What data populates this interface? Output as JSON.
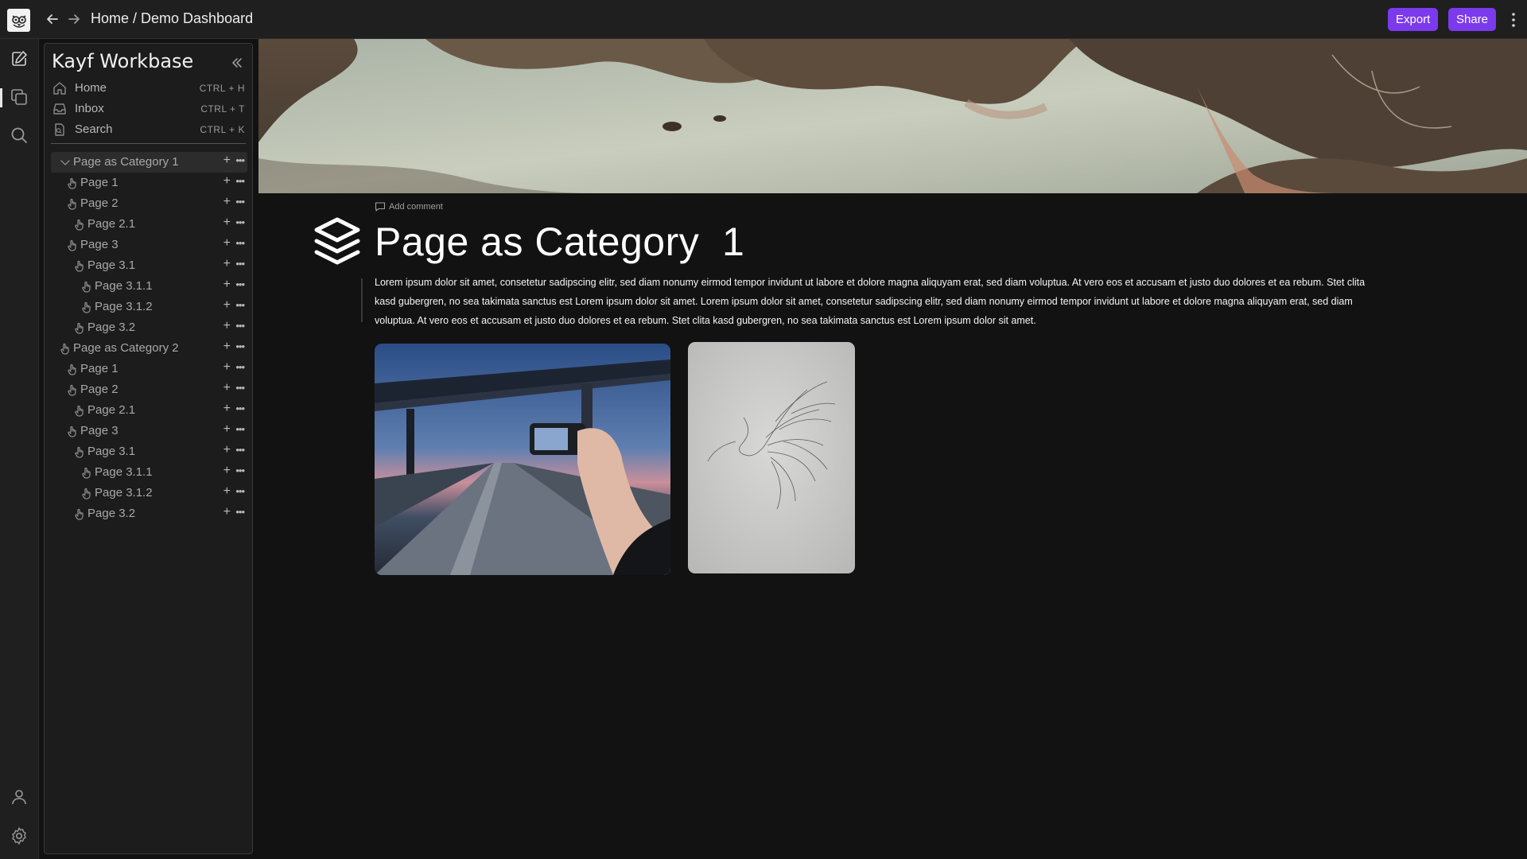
{
  "topbar": {
    "breadcrumb_home": "Home",
    "breadcrumb_sep": " / ",
    "breadcrumb_page": "Demo Dashboard",
    "export_label": "Export",
    "share_label": "Share",
    "accent": "#7c3aed"
  },
  "rail": {
    "icons": [
      "edit-icon",
      "copy-icon",
      "search-icon",
      "user-icon",
      "settings-icon"
    ]
  },
  "sidebar": {
    "title": "Kayf Workbase",
    "quick": [
      {
        "label": "Home",
        "shortcut": "CTRL + H",
        "icon": "home-icon"
      },
      {
        "label": "Inbox",
        "shortcut": "CTRL + T",
        "icon": "inbox-icon"
      },
      {
        "label": "Search",
        "shortcut": "CTRL + K",
        "icon": "search-doc-icon"
      }
    ],
    "tree": [
      {
        "label": "Page as Category 1",
        "level": 0,
        "expanded": true
      },
      {
        "label": "Page 1",
        "level": 1
      },
      {
        "label": "Page 2",
        "level": 1
      },
      {
        "label": "Page 2.1",
        "level": 2
      },
      {
        "label": "Page 3",
        "level": 1
      },
      {
        "label": "Page 3.1",
        "level": 2
      },
      {
        "label": "Page 3.1.1",
        "level": 3
      },
      {
        "label": "Page 3.1.2",
        "level": 3
      },
      {
        "label": "Page 3.2",
        "level": 2
      },
      {
        "label": "Page as Category 2",
        "level": 0
      },
      {
        "label": "Page 1",
        "level": 1
      },
      {
        "label": "Page 2",
        "level": 1
      },
      {
        "label": "Page 2.1",
        "level": 2
      },
      {
        "label": "Page 3",
        "level": 1
      },
      {
        "label": "Page 3.1",
        "level": 2
      },
      {
        "label": "Page 3.1.1",
        "level": 3
      },
      {
        "label": "Page 3.1.2",
        "level": 3
      },
      {
        "label": "Page 3.2",
        "level": 2
      }
    ]
  },
  "main": {
    "add_comment": "Add comment",
    "title": "Page as Category  1",
    "body": "Lorem ipsum dolor sit amet, consetetur sadipscing elitr, sed diam nonumy eirmod tempor invidunt ut labore et dolore magna aliquyam erat, sed diam voluptua. At vero eos et accusam et justo duo dolores et ea rebum. Stet clita kasd gubergren, no sea takimata sanctus est Lorem ipsum dolor sit amet. Lorem ipsum dolor sit amet, consetetur sadipscing elitr, sed diam nonumy eirmod tempor invidunt ut labore et dolore magna aliquyam erat, sed diam voluptua. At vero eos et accusam et justo duo dolores et ea rebum. Stet clita kasd gubergren, no sea takimata sanctus est Lorem ipsum dolor sit amet."
  }
}
